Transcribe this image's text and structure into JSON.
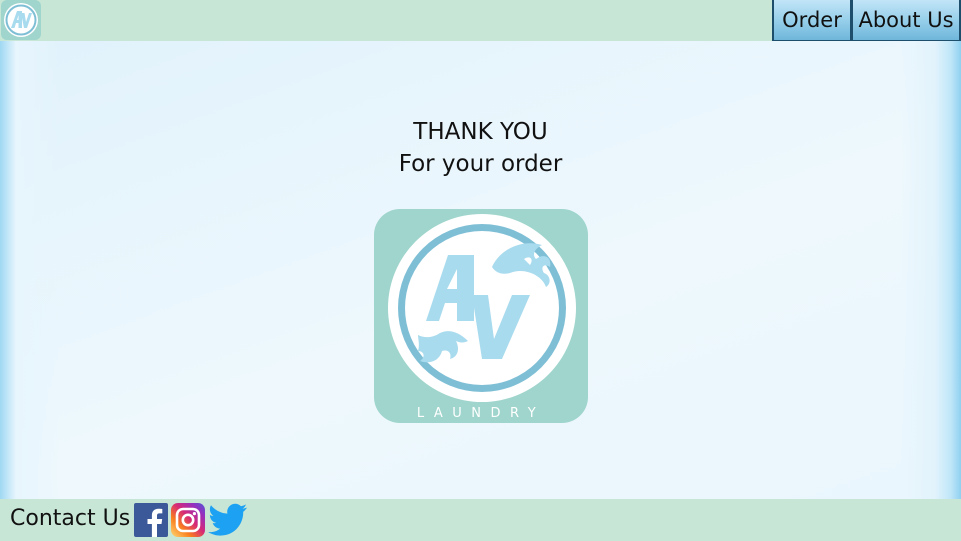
{
  "header": {
    "logo_icon": "av-laundry-logo-icon",
    "logo_text": "AV",
    "nav": [
      {
        "label": "Order"
      },
      {
        "label": "About Us"
      }
    ]
  },
  "main": {
    "thanks_line1": "THANK YOU",
    "thanks_line2": "For your order",
    "logo": {
      "icon": "av-laundry-logo-icon",
      "monogram": "AV",
      "wordmark": "LAUNDRY"
    }
  },
  "footer": {
    "contact_label": "Contact Us",
    "social": [
      {
        "icon": "facebook-icon"
      },
      {
        "icon": "instagram-icon"
      },
      {
        "icon": "twitter-icon"
      }
    ]
  },
  "colors": {
    "bar_green": "#c7e6d6",
    "logo_tile": "#9fd5cc",
    "logo_blue": "#a9dbee",
    "nav_border": "#1d4f6c"
  }
}
